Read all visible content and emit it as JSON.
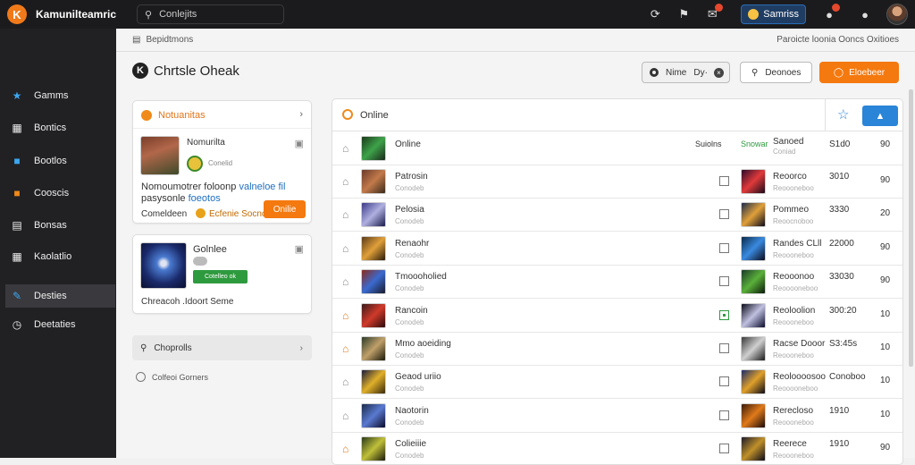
{
  "app": {
    "title": "Kamunilteamric",
    "search_placeholder": "Conlejits",
    "user_name": "Samriss"
  },
  "sidebar": {
    "items": [
      {
        "label": "Gamms",
        "icon": "star-icon",
        "color": "#3ba7f0"
      },
      {
        "label": "Bontics",
        "icon": "grid-icon",
        "color": "#cccccc"
      },
      {
        "label": "Bootlos",
        "icon": "chat-icon",
        "color": "#3ba7f0"
      },
      {
        "label": "Cooscis",
        "icon": "controller-icon",
        "color": "#f08a1a"
      },
      {
        "label": "Bonsas",
        "icon": "list-icon",
        "color": "#cccccc"
      },
      {
        "label": "Kaolatlio",
        "icon": "grid-icon",
        "color": "#cccccc"
      },
      {
        "label": "Desties",
        "icon": "edit-icon",
        "color": "#3ba7f0",
        "active": true
      },
      {
        "label": "Deetaties",
        "icon": "clock-icon",
        "color": "#cccccc"
      }
    ]
  },
  "breadcrumb": {
    "left": "Bepidtmons",
    "right": "Paroicte loonia Ooncs Oxitioes"
  },
  "page": {
    "title": "Chrtsle Oheak"
  },
  "header_buttons": {
    "filter_label": "Nime",
    "filter_value": "Dy·",
    "search_label": "Deonoes",
    "primary_label": "Eloebeer"
  },
  "notify_card": {
    "title": "Notuanitas",
    "item_title": "Nomurilta",
    "item_sub": "Conelid",
    "desc_line1": "Nomoumotrer foloonp",
    "desc_highlight": "valneloe fil",
    "desc_line2": "pasysonle",
    "desc_highlight2": "foeotos",
    "footer_text": "Comeldeen",
    "footer_badge": "Ecfenie Socnco",
    "action_label": "Onilie"
  },
  "game_card": {
    "title": "Golnlee",
    "tag": "Cotelleo ok",
    "desc": "Chreacoh .Idoort Seme"
  },
  "side_links": {
    "search_label": "Choprolls",
    "clock_label": "Colfeoi Gorners"
  },
  "table": {
    "header": {
      "label": "Online",
      "col1": "Online",
      "col2": "Suiolns",
      "col3": "Snowar",
      "col4": "Sanoed",
      "col4_sub": "Coniad",
      "col5": "S1d0",
      "col6": "90"
    },
    "rows": [
      {
        "name": "Patrosin",
        "sub": "Conodeb",
        "name2": "Reoorco",
        "sub2": "Reoooneboo",
        "value": "3010",
        "score": "90"
      },
      {
        "name": "Pelosia",
        "sub": "Conodeb",
        "name2": "Pommeo",
        "sub2": "Reoocnoboo",
        "value": "3330",
        "score": "20"
      },
      {
        "name": "Renaohr",
        "sub": "Conodeb",
        "name2": "Randes CLll",
        "sub2": "Reoooneboo",
        "value": "22000",
        "score": "90"
      },
      {
        "name": "Tmoooholied",
        "sub": "Conodeb",
        "name2": "Reooonoo",
        "sub2": "Reooooneboo",
        "value": "33030",
        "score": "90"
      },
      {
        "name": "Rancoin",
        "sub": "Conodeb",
        "name2": "Reoloolion",
        "sub2": "Reoooneboo",
        "value": "300:20",
        "score": "10",
        "checked": true
      },
      {
        "name": "Mmo aoeiding",
        "sub": "Conodeb",
        "name2": "Racse Dooor",
        "sub2": "Reoooneboo",
        "value": "S3:45s",
        "score": "10"
      },
      {
        "name": "Geaod uriio",
        "sub": "Conodeb",
        "name2": "Reoloooosoo",
        "sub2": "Reooooneboo",
        "value": "Conoboo",
        "score": "10"
      },
      {
        "name": "Naotorin",
        "sub": "Conodeb",
        "name2": "Rerecloso",
        "sub2": "Reoooneboo",
        "value": "1910",
        "score": "10"
      },
      {
        "name": "Colieiiie",
        "sub": "Conodeb",
        "name2": "Reerece",
        "sub2": "Reoooneboo",
        "value": "1910",
        "score": "90"
      }
    ]
  }
}
